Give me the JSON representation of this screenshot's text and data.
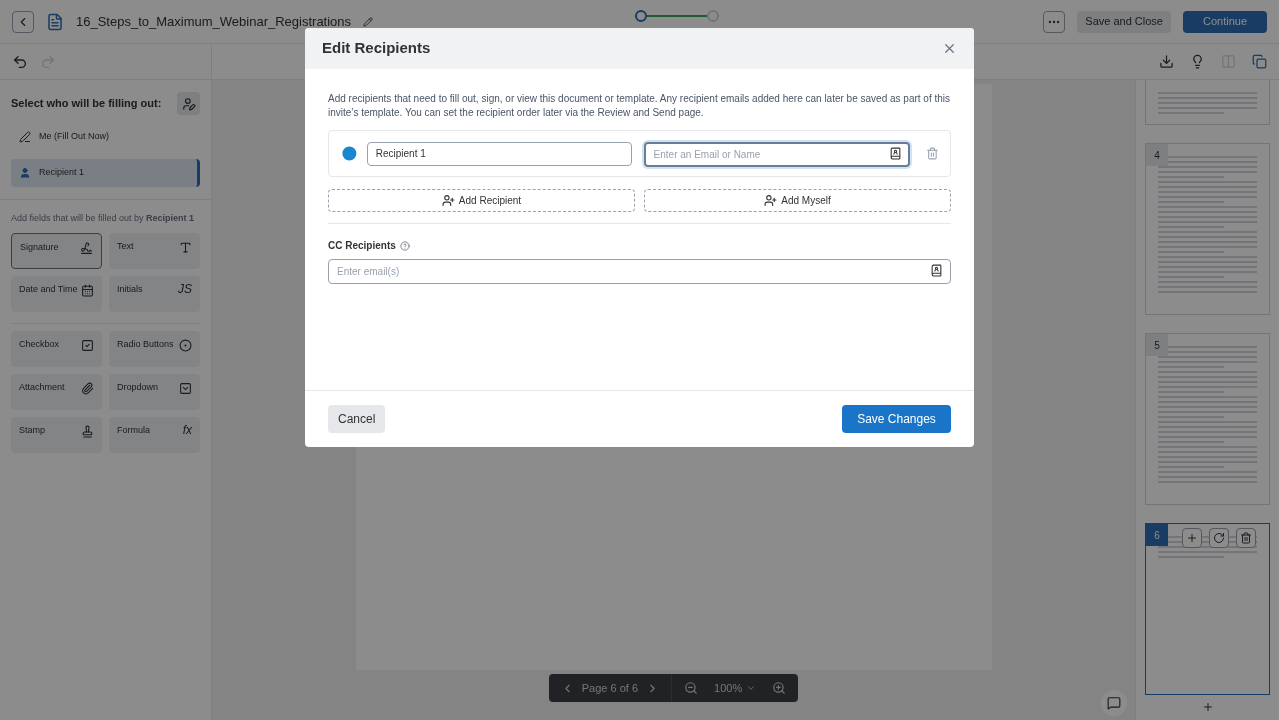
{
  "header": {
    "document_title": "16_Steps_to_Maximum_Webinar_Registrations",
    "steps": [
      {
        "selected": true
      },
      {
        "selected": false
      }
    ],
    "buttons": [
      {
        "kind": "secondary",
        "label": "Save and Close"
      },
      {
        "kind": "primary",
        "label": "Continue"
      }
    ]
  },
  "sidebar": {
    "heading": "Select who will be filling out:",
    "signers": [
      {
        "kind": "me",
        "label": "Me (Fill Out Now)",
        "selected": false
      },
      {
        "kind": "recipient",
        "label": "Recipient 1",
        "selected": true
      }
    ],
    "fields_hint": "Add fields that will be filled out by **Recipient 1**",
    "field_groups": [
      [
        {
          "kind": "signature",
          "label": "Signature",
          "selected": true
        },
        {
          "kind": "text",
          "label": "Text",
          "selected": false
        },
        {
          "kind": "datetime",
          "label": "Date and Time",
          "selected": false
        },
        {
          "kind": "initials",
          "label": "Initials",
          "icon_text": "JS",
          "selected": false
        }
      ],
      [
        {
          "kind": "checkbox",
          "label": "Checkbox",
          "selected": false
        },
        {
          "kind": "radio",
          "label": "Radio Buttons",
          "selected": false
        },
        {
          "kind": "attachment",
          "label": "Attachment",
          "selected": false
        },
        {
          "kind": "dropdown",
          "label": "Dropdown",
          "selected": false
        },
        {
          "kind": "stamp",
          "label": "Stamp",
          "selected": false
        },
        {
          "kind": "formula",
          "label": "Formula",
          "icon_text": "fx",
          "selected": false
        }
      ]
    ]
  },
  "pager": {
    "page_label": "Page 6 of 6",
    "zoom": "100%"
  },
  "thumbnails": [
    {
      "number": "4",
      "selected": false
    },
    {
      "number": "5",
      "selected": false
    },
    {
      "number": "6",
      "selected": true
    }
  ],
  "modal": {
    "title": "Edit Recipients",
    "description": "Add recipients that need to fill out, sign, or view this document or template. Any recipient emails added here can later be saved as part of this invite’s template. You can set the recipient order later via the Review and Send page.",
    "recipients": [
      {
        "name": "Recipient 1",
        "email_placeholder": "Enter an Email or Name"
      }
    ],
    "add_buttons": [
      "Add Recipient",
      "Add Myself"
    ],
    "cc_label": "CC Recipients",
    "cc_placeholder": "Enter email(s)",
    "cancel": "Cancel",
    "save": "Save Changes"
  }
}
